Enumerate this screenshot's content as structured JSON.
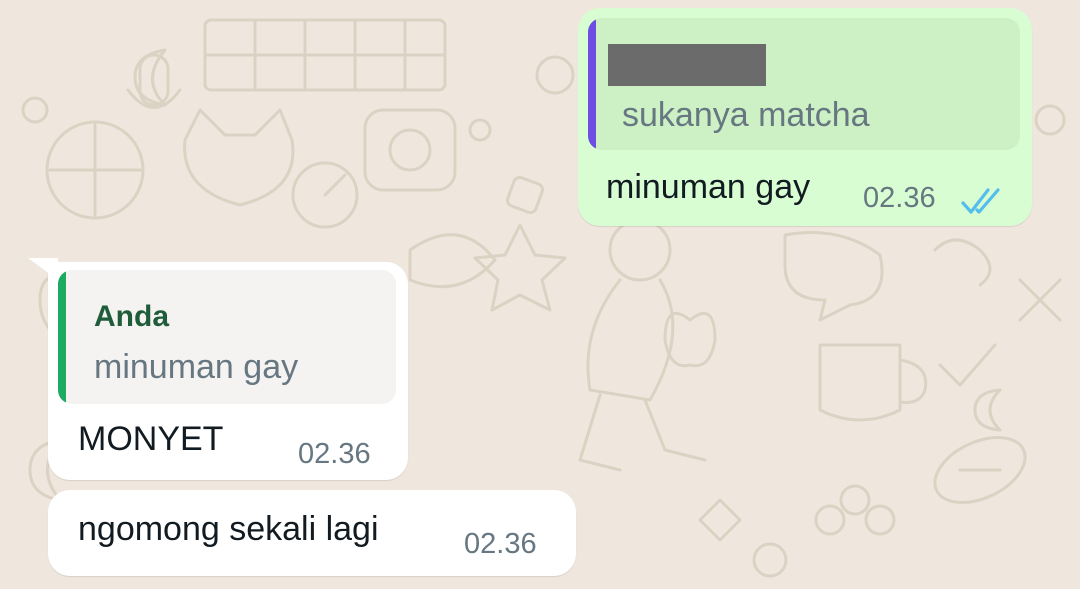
{
  "colors": {
    "wallpaper": "#efe7dd",
    "outgoing_bubble": "#d9fdd3",
    "outgoing_quote_bg": "#cdf0c5",
    "incoming_bubble": "#ffffff",
    "incoming_quote_bg": "#f5f3f1",
    "quote_bar_outgoing": "#6e4ee0",
    "quote_bar_incoming": "#1daa61",
    "quote_name_incoming": "#1f5c3a",
    "read_tick": "#53bdeb",
    "timestamp": "#667781"
  },
  "messages": [
    {
      "direction": "outgoing",
      "quoted": {
        "sender": "",
        "sender_redacted": true,
        "text": "sukanya matcha"
      },
      "text": "minuman gay",
      "time": "02.36",
      "status_icon": "double-check-read-icon"
    },
    {
      "direction": "incoming",
      "quoted": {
        "sender": "Anda",
        "text": "minuman gay"
      },
      "text": "MONYET",
      "time": "02.36"
    },
    {
      "direction": "incoming",
      "text": "ngomong sekali lagi",
      "time": "02.36"
    }
  ]
}
